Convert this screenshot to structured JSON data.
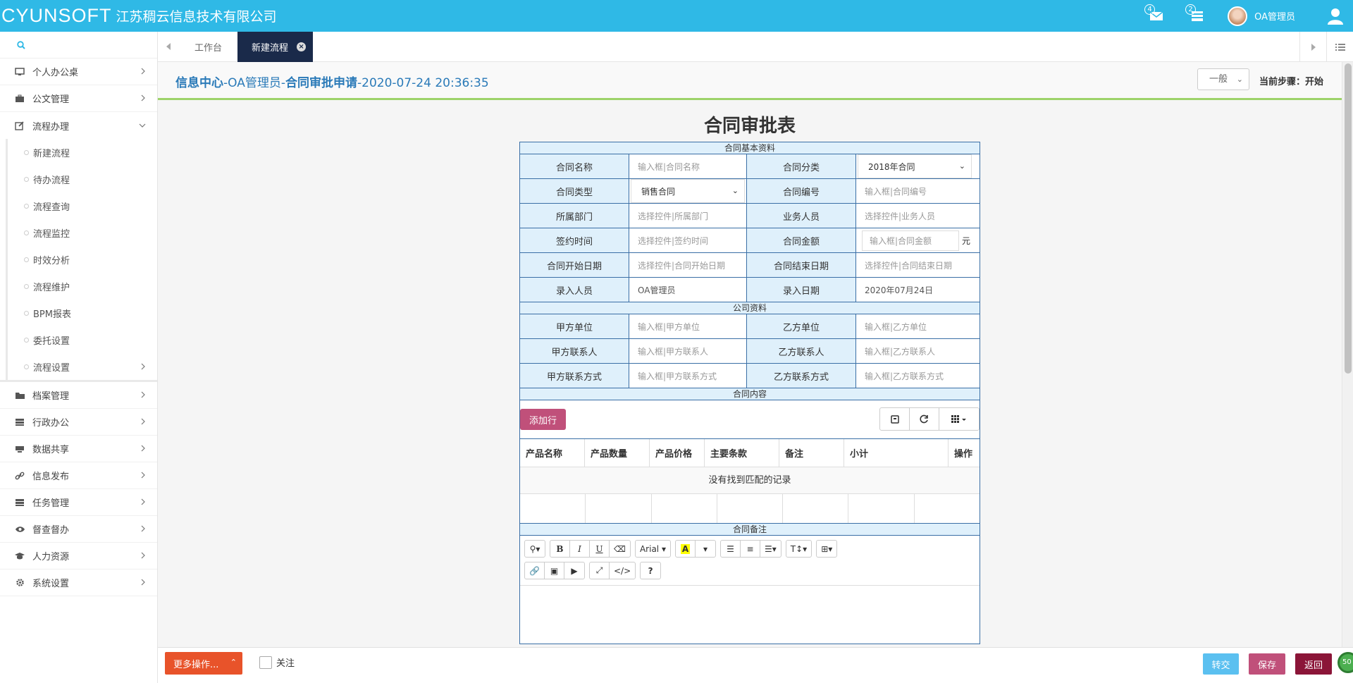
{
  "header": {
    "logo": "CYUNSOFT",
    "company": "江苏稠云信息技术有限公司",
    "mail_badge": "4",
    "task_badge": "2",
    "user_name": "OA管理员"
  },
  "sidebar": {
    "menu_top": [
      {
        "label": "个人办公桌",
        "icon": "monitor-icon"
      },
      {
        "label": "公文管理",
        "icon": "briefcase-icon"
      },
      {
        "label": "流程办理",
        "icon": "edit-icon"
      }
    ],
    "submenu": [
      "新建流程",
      "待办流程",
      "流程查询",
      "流程监控",
      "时效分析",
      "流程维护",
      "BPM报表",
      "委托设置",
      "流程设置"
    ],
    "menu_bottom": [
      {
        "label": "档案管理",
        "icon": "folder-icon"
      },
      {
        "label": "行政办公",
        "icon": "server-icon"
      },
      {
        "label": "数据共享",
        "icon": "database-icon"
      },
      {
        "label": "信息发布",
        "icon": "link-icon"
      },
      {
        "label": "任务管理",
        "icon": "tasks-icon"
      },
      {
        "label": "督查督办",
        "icon": "eye-icon"
      },
      {
        "label": "人力资源",
        "icon": "graduation-icon"
      },
      {
        "label": "系统设置",
        "icon": "gear-icon"
      }
    ]
  },
  "tabs": [
    {
      "label": "工作台"
    },
    {
      "label": "新建流程"
    }
  ],
  "title_bar": {
    "part1": "信息中心",
    "sep1": "-",
    "part2": "OA管理员",
    "sep2": "-",
    "part3": "合同审批申请",
    "sep3": "-",
    "datetime": "2020-07-24 20:36:35",
    "level": "一般",
    "step": "当前步骤：开始"
  },
  "form": {
    "title": "合同审批表",
    "section_basic": "合同基本资料",
    "section_company": "公司资料",
    "section_content": "合同内容",
    "section_remark": "合同备注",
    "name_label": "合同名称",
    "name_ph": "输入框|合同名称",
    "category_label": "合同分类",
    "category_val": "2018年合同",
    "type_label": "合同类型",
    "type_val": "销售合同",
    "no_label": "合同编号",
    "no_ph": "输入框|合同编号",
    "dept_label": "所属部门",
    "dept_ph": "选择控件|所属部门",
    "sales_label": "业务人员",
    "sales_ph": "选择控件|业务人员",
    "sign_label": "签约时间",
    "sign_ph": "选择控件|签约时间",
    "amount_label": "合同金额",
    "amount_ph": "输入框|合同金额",
    "amount_unit": "元",
    "start_label": "合同开始日期",
    "start_ph": "选择控件|合同开始日期",
    "end_label": "合同结束日期",
    "end_ph": "选择控件|合同结束日期",
    "entry_label": "录入人员",
    "entry_val": "OA管理员",
    "entry_date_label": "录入日期",
    "entry_date_val": "2020年07月24日",
    "partyA_label": "甲方单位",
    "partyA_ph": "输入框|甲方单位",
    "partyB_label": "乙方单位",
    "partyB_ph": "输入框|乙方单位",
    "contactA_label": "甲方联系人",
    "contactA_ph": "输入框|甲方联系人",
    "contactB_label": "乙方联系人",
    "contactB_ph": "输入框|乙方联系人",
    "phoneA_label": "甲方联系方式",
    "phoneA_ph": "输入框|甲方联系方式",
    "phoneB_label": "乙方联系方式",
    "phoneB_ph": "输入框|乙方联系方式",
    "add_row": "添加行",
    "columns": [
      "产品名称",
      "产品数量",
      "产品价格",
      "主要条款",
      "备注",
      "小计",
      "操作"
    ],
    "no_records": "没有找到匹配的记录",
    "font_name": "Arial"
  },
  "footer": {
    "more": "更多操作...",
    "follow": "关注",
    "transfer": "转交",
    "save": "保存",
    "back": "返回",
    "corner_badge": "50"
  }
}
